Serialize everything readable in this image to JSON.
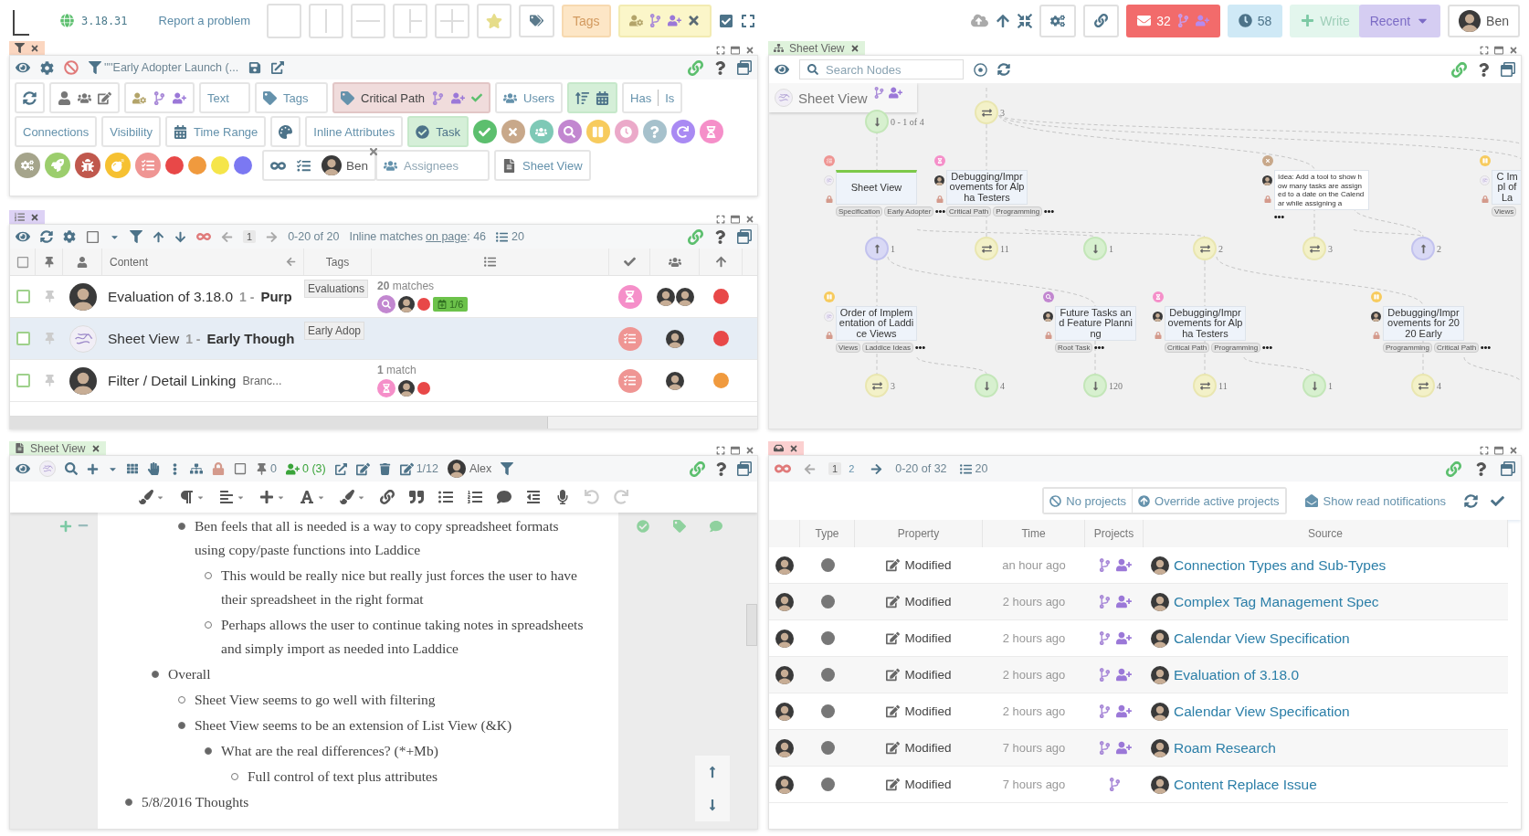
{
  "topbar": {
    "version": "3.18.31",
    "report_link": "Report a problem",
    "tags_button": "Tags",
    "mail_count": "32",
    "timer_count": "58",
    "write_button": "Write",
    "recent_button": "Recent",
    "user": "Ben"
  },
  "filter_panel": {
    "filter_name": "''''Early Adopter Launch (...",
    "text_button": "Text",
    "tags_button": "Tags",
    "critical_path": {
      "label": "Critical Path",
      "selected": true
    },
    "users_button": "Users",
    "has_button": "Has",
    "is_button": "Is",
    "connections_button": "Connections",
    "visibility_button": "Visibility",
    "time_range_button": "Time Range",
    "inline_attributes_button": "Inline Attributes",
    "task_toggle": {
      "label": "Task",
      "selected": true
    },
    "status_filters": [
      {
        "kind": "check",
        "color": "#5cbf6e"
      },
      {
        "kind": "times",
        "color": "#c8a88a"
      },
      {
        "kind": "users",
        "color": "#7ec9b6"
      },
      {
        "kind": "search",
        "color": "#c287d0"
      },
      {
        "kind": "pause",
        "color": "#f7cb5e"
      },
      {
        "kind": "clock",
        "color": "#eba9c9"
      },
      {
        "kind": "question",
        "color": "#a6c1cc"
      },
      {
        "kind": "redo",
        "color": "#a98af3"
      },
      {
        "kind": "hourglass",
        "color": "#f58fc9"
      }
    ],
    "category_filters": [
      {
        "kind": "cogs",
        "color": "#a5a48b"
      },
      {
        "kind": "rocket",
        "color": "#9cce6d"
      },
      {
        "kind": "bug",
        "color": "#c0584d"
      },
      {
        "kind": "bomb",
        "color": "#f6c132"
      },
      {
        "kind": "list",
        "color": "#ef9593"
      },
      {
        "kind": "dot",
        "color": "#e84848"
      },
      {
        "kind": "dot",
        "color": "#f09a3e"
      },
      {
        "kind": "dot",
        "color": "#f5e54a"
      },
      {
        "kind": "dot",
        "color": "#7b78f2"
      }
    ],
    "assignee": "Ben",
    "assignees_button": "Assignees",
    "view_button": "Sheet View"
  },
  "list_panel": {
    "page": "1",
    "range": "0-20 of 20",
    "inline_label": "Inline matches",
    "inline_link": "on page",
    "inline_count": ": 46",
    "page_size": "20",
    "columns": {
      "content": "Content",
      "tags": "Tags"
    },
    "rows": [
      {
        "owner": {
          "kind": "avatar"
        },
        "title": "Evaluation of 3.18.0",
        "number": "1 -",
        "subtitle": {
          "text": "Purp",
          "kind": "bold"
        },
        "tag": "Evaluations",
        "matches_count": "20",
        "matches_label": "matches",
        "match_icons": [
          {
            "kind": "search",
            "color": "#c287d0"
          },
          {
            "kind": "avatar"
          },
          {
            "kind": "dot",
            "color": "#e84848"
          },
          {
            "kind": "badge",
            "label": "1/6",
            "color": "#6cc24a"
          }
        ],
        "status": {
          "kind": "hourglass",
          "color": "#f58fc9"
        },
        "assignees": [
          {
            "kind": "avatar"
          },
          {
            "kind": "avatar"
          }
        ],
        "priority": {
          "color": "#e84848"
        },
        "selected": false
      },
      {
        "owner": {
          "kind": "mindmap"
        },
        "title": "Sheet View",
        "number": "1 -",
        "subtitle": {
          "text": "Early Though",
          "kind": "bold"
        },
        "tag": "Early Adop",
        "status": {
          "kind": "list",
          "color": "#ef9593"
        },
        "assignees": [
          {
            "kind": "avatar"
          }
        ],
        "priority": {
          "color": "#e84848"
        },
        "selected": true
      },
      {
        "owner": {
          "kind": "avatar"
        },
        "title": "Filter / Detail Linking",
        "subtitle": {
          "text": "Branc...",
          "kind": "plain"
        },
        "matches_count": "1",
        "matches_label": "match",
        "match_icons": [
          {
            "kind": "hourglass",
            "color": "#f58fc9"
          },
          {
            "kind": "avatar"
          },
          {
            "kind": "dot",
            "color": "#e84848"
          }
        ],
        "status": {
          "kind": "list",
          "color": "#ef9593"
        },
        "assignees": [
          {
            "kind": "avatar"
          }
        ],
        "priority": {
          "color": "#f09a3e"
        },
        "selected": false
      }
    ]
  },
  "tree_panel": {
    "tab": "Sheet View",
    "search_placeholder": "Search Nodes",
    "root_title": "Sheet View",
    "connectors": [
      {
        "kind": "down",
        "count": "0 - 1 of 4"
      },
      {
        "kind": "swap",
        "count": "3"
      },
      {
        "kind": "up",
        "count": "1"
      },
      {
        "kind": "swap",
        "count": "11"
      },
      {
        "kind": "down",
        "count": "1"
      },
      {
        "kind": "swap",
        "count": "2"
      },
      {
        "kind": "swap",
        "count": "3"
      },
      {
        "kind": "up",
        "count": "2"
      },
      {
        "kind": "swap",
        "count": "3"
      },
      {
        "kind": "down",
        "count": "4"
      },
      {
        "kind": "down",
        "count": "120"
      },
      {
        "kind": "swap",
        "count": "11"
      },
      {
        "kind": "down",
        "count": "1"
      },
      {
        "kind": "swap",
        "count": "4"
      }
    ],
    "nodes": [
      {
        "kind": "task",
        "title": "Sheet View",
        "tags": [
          "Specification",
          "Early Adopter"
        ],
        "status": {
          "kind": "list",
          "color": "#ef9593"
        },
        "owner": {
          "kind": "mindmap"
        },
        "selected": true
      },
      {
        "kind": "task",
        "title": "Debugging/Improvements for Alpha Testers",
        "tags": [
          "Critical Path",
          "Programming"
        ],
        "status": {
          "kind": "hourglass",
          "color": "#f58fc9"
        },
        "owner": {
          "kind": "avatar"
        },
        "selected": false
      },
      {
        "kind": "note",
        "title": "Idea: Add a tool to show how many tasks are assigned to a date on the Calendar while assigning a",
        "status": {
          "kind": "times",
          "color": "#c8a88a"
        },
        "owner": {
          "kind": "avatar"
        },
        "selected": false
      },
      {
        "kind": "task",
        "title": "C Impl of La",
        "tags": [
          "Views"
        ],
        "status": {
          "kind": "pause",
          "color": "#f7cb5e"
        },
        "owner": {
          "kind": "mindmap"
        },
        "selected": false
      },
      {
        "kind": "task",
        "title": "Order of Implementation of Laddice Views",
        "tags": [
          "Views",
          "Laddice Ideas"
        ],
        "status": {
          "kind": "pause",
          "color": "#f7cb5e"
        },
        "owner": {
          "kind": "mindmap"
        },
        "selected": false
      },
      {
        "kind": "task",
        "title": "Future Tasks and Feature Planning",
        "tags": [
          "Root Task"
        ],
        "status": {
          "kind": "search",
          "color": "#c287d0"
        },
        "owner": {
          "kind": "avatar"
        },
        "selected": false
      },
      {
        "kind": "task",
        "title": "Debugging/Improvements for Alpha Testers",
        "tags": [
          "Critical Path",
          "Programming"
        ],
        "status": {
          "kind": "hourglass",
          "color": "#f58fc9"
        },
        "owner": {
          "kind": "avatar"
        },
        "selected": false
      },
      {
        "kind": "task",
        "title": "Debugging/Improvements for 2020 Early",
        "tags": [
          "Programming",
          "Critical Path"
        ],
        "status": {
          "kind": "pause",
          "color": "#f7cb5e"
        },
        "owner": {
          "kind": "avatar"
        },
        "selected": false
      }
    ]
  },
  "editor_panel": {
    "tab": "Sheet View",
    "pin_count": "0",
    "assign_count": "0 (3)",
    "edit_count": "1/12",
    "user": "Alex",
    "outline": [
      {
        "children": [
          {
            "children": [
              {
                "text": "Ben feels that all is needed is a way to copy spreadsheet formats using copy/paste functions into Laddice",
                "filled": true,
                "children": [
                  {
                    "text": "This would be really nice but really just forces the user to have their spreadsheet in the right format",
                    "filled": false
                  },
                  {
                    "text": "Perhaps allows the user to continue taking notes in spreadsheets and simply import as needed into Laddice",
                    "filled": false
                  }
                ]
              }
            ]
          },
          {
            "text": "Overall",
            "filled": true,
            "children": [
              {
                "text": "Sheet View seems to go well with filtering",
                "filled": false
              },
              {
                "text": "Sheet View seems to be an extension of List View (&K)",
                "filled": true,
                "children": [
                  {
                    "text": "What are the real differences? (*+Mb)",
                    "filled": true,
                    "children": [
                      {
                        "text": "Full control of text plus attributes",
                        "filled": false
                      }
                    ]
                  }
                ]
              }
            ]
          }
        ]
      },
      {
        "text": "5/8/2016 Thoughts",
        "filled": true
      }
    ]
  },
  "notifications_panel": {
    "pages": [
      {
        "label": "1",
        "selected": true
      },
      {
        "label": "2",
        "selected": false
      }
    ],
    "range": "0-20 of 32",
    "page_size": "20",
    "no_projects_button": "No projects",
    "override_button": "Override active projects",
    "show_read_button": "Show read notifications",
    "columns": [
      "Type",
      "Property",
      "Time",
      "Projects",
      "Source"
    ],
    "rows": [
      {
        "property": "Modified",
        "time": "an hour ago",
        "projects": [
          {
            "kind": "branch"
          },
          {
            "kind": "user-plus"
          }
        ],
        "source": "Connection Types and Sub-Types"
      },
      {
        "property": "Modified",
        "time": "2 hours ago",
        "projects": [
          {
            "kind": "branch"
          },
          {
            "kind": "user-plus"
          }
        ],
        "source": "Complex Tag Management Spec"
      },
      {
        "property": "Modified",
        "time": "2 hours ago",
        "projects": [
          {
            "kind": "branch"
          },
          {
            "kind": "user-plus"
          }
        ],
        "source": "Calendar View Specification"
      },
      {
        "property": "Modified",
        "time": "2 hours ago",
        "projects": [
          {
            "kind": "branch"
          },
          {
            "kind": "user-plus"
          }
        ],
        "source": "Evaluation of 3.18.0"
      },
      {
        "property": "Modified",
        "time": "2 hours ago",
        "projects": [
          {
            "kind": "branch"
          },
          {
            "kind": "user-plus"
          }
        ],
        "source": "Calendar View Specification"
      },
      {
        "property": "Modified",
        "time": "7 hours ago",
        "projects": [
          {
            "kind": "branch"
          },
          {
            "kind": "user-plus"
          }
        ],
        "source": "Roam Research"
      },
      {
        "property": "Modified",
        "time": "7 hours ago",
        "projects": [
          {
            "kind": "branch"
          }
        ],
        "source": "Content Replace Issue"
      }
    ]
  }
}
